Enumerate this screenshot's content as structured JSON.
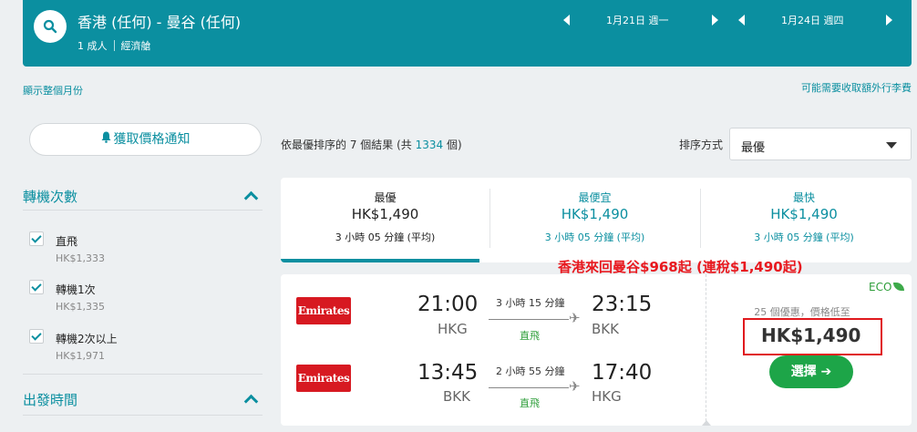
{
  "search": {
    "route": "香港 (任何) - 曼谷 (任何)",
    "passengers": "1 成人",
    "cabin": "經濟艙",
    "depart_date": "1月21日 週一",
    "return_date": "1月24日 週四"
  },
  "links": {
    "show_month": "顯示整個月份",
    "baggage_fees": "可能需要收取額外行李費"
  },
  "sidebar": {
    "price_alert_label": "獲取價格通知",
    "stops_title": "轉機次數",
    "stops": [
      {
        "label": "直飛",
        "price": "HK$1,333",
        "checked": true
      },
      {
        "label": "轉機1次",
        "price": "HK$1,335",
        "checked": true
      },
      {
        "label": "轉機2次以上",
        "price": "HK$1,971",
        "checked": true
      }
    ],
    "departure_title": "出發時間"
  },
  "results": {
    "summary_prefix": "依最優排序的 7 個結果 (共 ",
    "total": "1334",
    "summary_suffix": " 個)",
    "sort_label": "排序方式",
    "sort_value": "最優"
  },
  "tabs": [
    {
      "label": "最優",
      "price": "HK$1,490",
      "duration": "3 小時 05 分鐘 (平均)",
      "selected": true
    },
    {
      "label": "最便宜",
      "price": "HK$1,490",
      "duration": "3 小時 05 分鐘 (平均)",
      "selected": false
    },
    {
      "label": "最快",
      "price": "HK$1,490",
      "duration": "3 小時 05 分鐘 (平均)",
      "selected": false
    }
  ],
  "card": {
    "airline": "Emirates",
    "outbound": {
      "dep_time": "21:00",
      "dep_code": "HKG",
      "duration": "3 小時 15 分鐘",
      "stops": "直飛",
      "arr_time": "23:15",
      "arr_code": "BKK"
    },
    "inbound": {
      "dep_time": "13:45",
      "dep_code": "BKK",
      "duration": "2 小時 55 分鐘",
      "stops": "直飛",
      "arr_time": "17:40",
      "arr_code": "HKG"
    },
    "eco_label": "ECO",
    "deals": "25 個優惠，價格低至",
    "price": "HK$1,490",
    "select_label": "選擇 ➔"
  },
  "annotation": "香港來回曼谷$968起 (連稅$1,490起)",
  "colors": {
    "brand": "#0b8fa0",
    "green": "#1da548",
    "airline_red": "#d71921",
    "annotation_red": "#e8191f"
  }
}
